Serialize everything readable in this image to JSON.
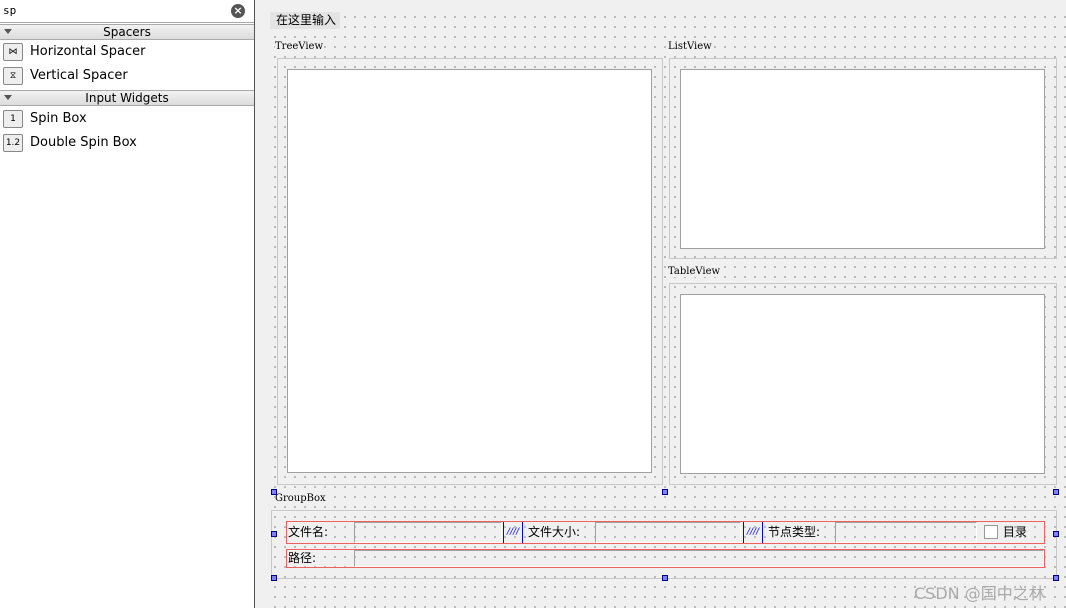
{
  "widget_box": {
    "search_value": "sp",
    "categories": [
      {
        "title": "Spacers",
        "items": [
          {
            "label": "Horizontal Spacer",
            "icon": "horizontal-spacer-icon"
          },
          {
            "label": "Vertical Spacer",
            "icon": "vertical-spacer-icon"
          }
        ]
      },
      {
        "title": "Input Widgets",
        "items": [
          {
            "label": "Spin Box",
            "icon": "spin-box-icon",
            "glyph": "1"
          },
          {
            "label": "Double Spin Box",
            "icon": "double-spin-box-icon",
            "glyph": "1.2"
          }
        ]
      }
    ]
  },
  "form": {
    "line_edit_text": "在这里输入",
    "tree_view": "TreeView",
    "list_view": "ListView",
    "table_view": "TableView",
    "group_box": "GroupBox",
    "row1": {
      "file_name": "文件名:",
      "file_size": "文件大小:",
      "node_type": "节点类型:",
      "checkbox": "目录",
      "checked": false
    },
    "row2": {
      "path": "路径:"
    }
  },
  "watermark": "CSDN @国中之林",
  "colors": {
    "selection_handle": "#8080ff",
    "layout_border": "#f06060",
    "spacer": "#0000ff"
  }
}
